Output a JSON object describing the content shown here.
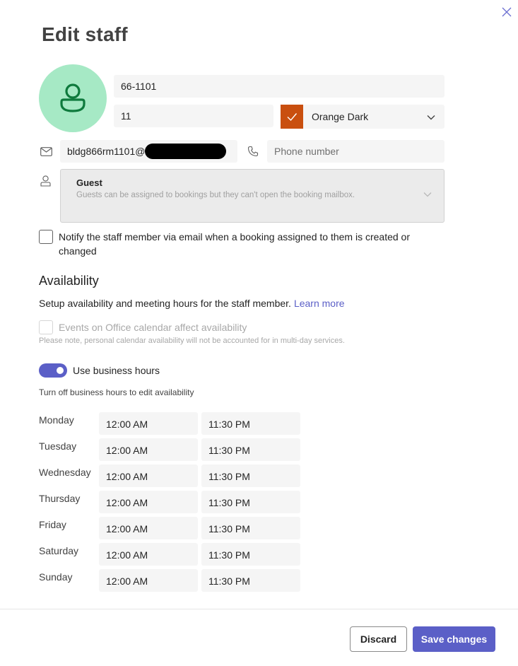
{
  "dialog": {
    "title": "Edit staff",
    "close_icon": "close-icon"
  },
  "profile": {
    "avatar_icon": "person-icon",
    "name_value": "66-1101",
    "initials_value": "11",
    "color_name": "Orange Dark",
    "color_hex": "#c94f0f",
    "email_value": "bldg866rm1101@",
    "email_icon": "mail-icon",
    "phone_placeholder": "Phone number",
    "phone_icon": "phone-icon",
    "role_icon": "person-icon"
  },
  "role": {
    "title": "Guest",
    "description": "Guests can be assigned to bookings but they can't open the booking mailbox."
  },
  "notify": {
    "checked": false,
    "label": "Notify the staff member via email when a booking assigned to them is created or changed"
  },
  "availability": {
    "heading": "Availability",
    "description": "Setup availability and meeting hours for the staff member.",
    "learn_more": "Learn more",
    "events_label": "Events on Office calendar affect availability",
    "note": "Please note, personal calendar availability will not be accounted for in multi-day services.",
    "use_business_hours_label": "Use business hours",
    "use_business_hours_on": true,
    "turn_off_hint": "Turn off business hours to edit availability"
  },
  "schedule": [
    {
      "day": "Monday",
      "start": "12:00 AM",
      "end": "11:30 PM"
    },
    {
      "day": "Tuesday",
      "start": "12:00 AM",
      "end": "11:30 PM"
    },
    {
      "day": "Wednesday",
      "start": "12:00 AM",
      "end": "11:30 PM"
    },
    {
      "day": "Thursday",
      "start": "12:00 AM",
      "end": "11:30 PM"
    },
    {
      "day": "Friday",
      "start": "12:00 AM",
      "end": "11:30 PM"
    },
    {
      "day": "Saturday",
      "start": "12:00 AM",
      "end": "11:30 PM"
    },
    {
      "day": "Sunday",
      "start": "12:00 AM",
      "end": "11:30 PM"
    }
  ],
  "footer": {
    "discard_label": "Discard",
    "save_label": "Save changes"
  },
  "colors": {
    "accent": "#5b5fc7",
    "avatar_bg": "#a6e9c5",
    "avatar_fg": "#0e7a3d"
  }
}
